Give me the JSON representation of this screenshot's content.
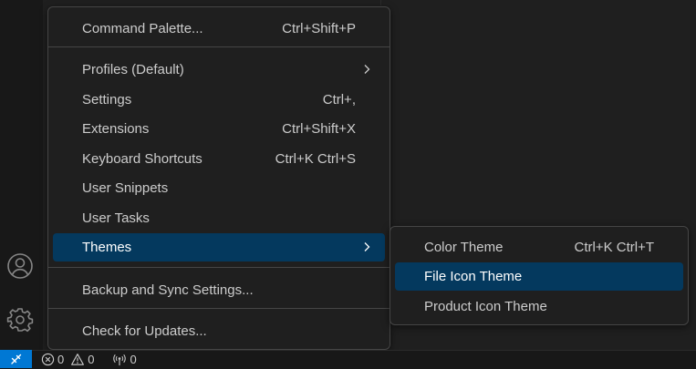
{
  "main_menu": {
    "items": [
      {
        "label": "Command Palette...",
        "shortcut": "Ctrl+Shift+P"
      },
      {
        "label": "Profiles (Default)",
        "shortcut": ""
      },
      {
        "label": "Settings",
        "shortcut": "Ctrl+,"
      },
      {
        "label": "Extensions",
        "shortcut": "Ctrl+Shift+X"
      },
      {
        "label": "Keyboard Shortcuts",
        "shortcut": "Ctrl+K Ctrl+S"
      },
      {
        "label": "User Snippets",
        "shortcut": ""
      },
      {
        "label": "User Tasks",
        "shortcut": ""
      },
      {
        "label": "Themes",
        "shortcut": ""
      },
      {
        "label": "Backup and Sync Settings...",
        "shortcut": ""
      },
      {
        "label": "Check for Updates...",
        "shortcut": ""
      }
    ]
  },
  "themes_submenu": {
    "items": [
      {
        "label": "Color Theme",
        "shortcut": "Ctrl+K Ctrl+T"
      },
      {
        "label": "File Icon Theme",
        "shortcut": ""
      },
      {
        "label": "Product Icon Theme",
        "shortcut": ""
      }
    ]
  },
  "status_bar": {
    "errors": "0",
    "warnings": "0",
    "ports": "0"
  },
  "icons": {
    "activity_bar": [
      "accounts-icon",
      "manage-gear-icon"
    ],
    "status_bar": [
      "remote-icon",
      "error-icon",
      "warning-icon",
      "ports-icon"
    ],
    "menu": [
      "chevron-right-icon"
    ]
  },
  "colors": {
    "selection": "#04395e",
    "remote_indicator": "#0078d4",
    "menu_background": "#1f1f1f",
    "menu_border": "#454545"
  }
}
